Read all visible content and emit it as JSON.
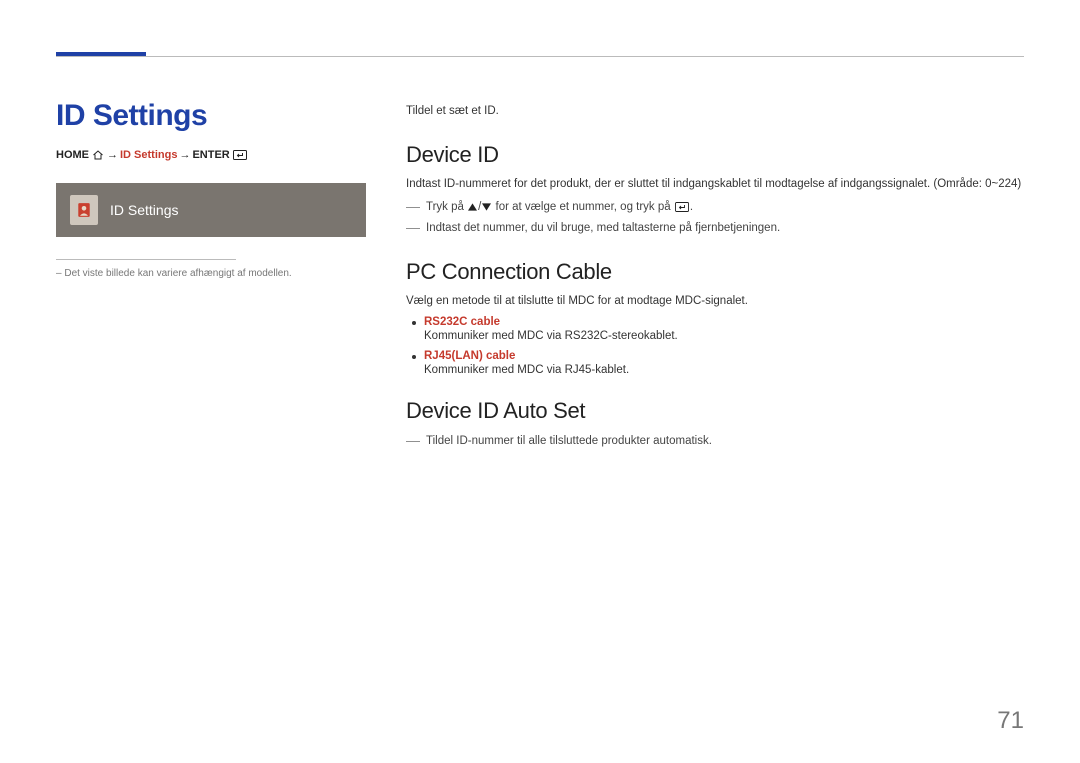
{
  "page_number": "71",
  "left": {
    "title": "ID Settings",
    "breadcrumb": {
      "home": "HOME",
      "arrow": "→",
      "current": "ID Settings",
      "enter": "ENTER"
    },
    "mock_label": "ID Settings",
    "caption_prefix": "–",
    "caption": "Det viste billede kan variere afhængigt af modellen."
  },
  "right": {
    "intro": "Tildel et sæt et ID.",
    "s1": {
      "heading": "Device ID",
      "p1": "Indtast ID-nummeret for det produkt, der er sluttet til indgangskablet til modtagelse af indgangssignalet. (Område: 0~224)",
      "d1a": "Tryk på",
      "d1b": "for at vælge et nummer, og tryk på",
      "d1c": ".",
      "d2": "Indtast det nummer, du vil bruge, med taltasterne på fjernbetjeningen."
    },
    "s2": {
      "heading": "PC Connection Cable",
      "p1": "Vælg en metode til at tilslutte til MDC for at modtage MDC-signalet.",
      "b1_title": "RS232C cable",
      "b1_desc": "Kommuniker med MDC via RS232C-stereokablet.",
      "b2_title": "RJ45(LAN) cable",
      "b2_desc": "Kommuniker med MDC via RJ45-kablet."
    },
    "s3": {
      "heading": "Device ID Auto Set",
      "d1": "Tildel ID-nummer til alle tilsluttede produkter automatisk."
    }
  }
}
